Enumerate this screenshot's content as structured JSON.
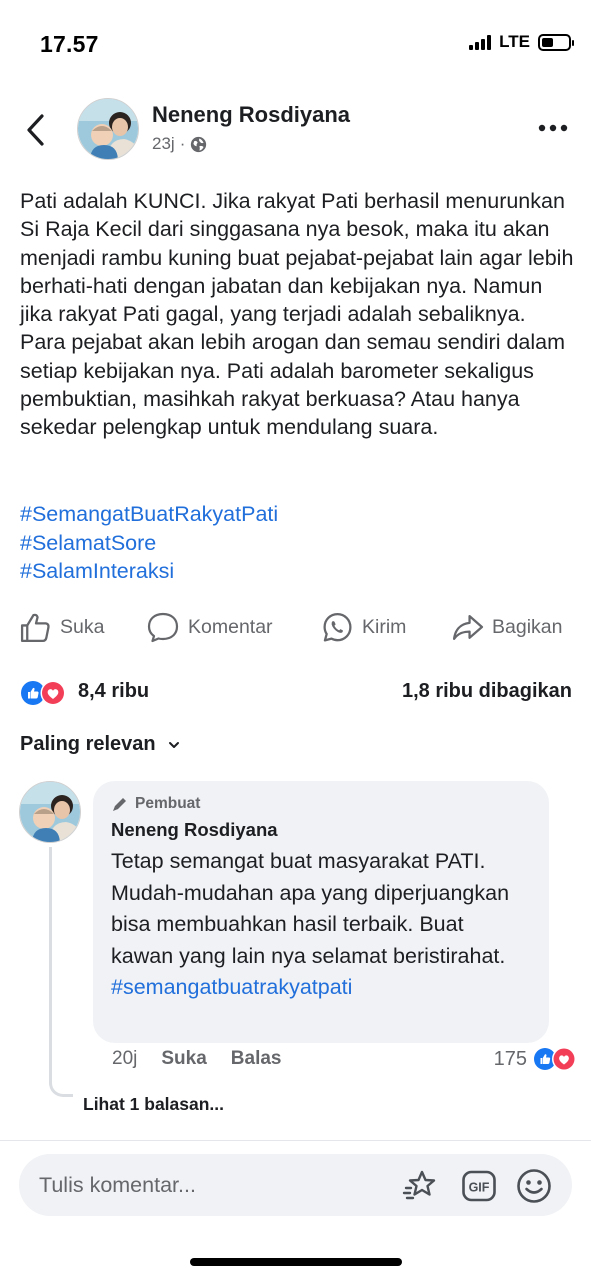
{
  "status_bar": {
    "time": "17.57",
    "network": "LTE",
    "battery_level": 0.45
  },
  "header": {
    "author_name": "Neneng Rosdiyana",
    "post_age": "23j",
    "separator": "·",
    "privacy_icon": "globe-icon"
  },
  "post": {
    "text": "Pati adalah KUNCI. Jika rakyat Pati berhasil menurunkan Si Raja Kecil dari singgasana nya besok, maka itu akan menjadi rambu kuning buat pejabat-pejabat lain agar lebih berhati-hati dengan jabatan dan kebijakan nya. Namun jika rakyat Pati gagal, yang terjadi adalah sebaliknya. Para pejabat akan lebih arogan dan semau sendiri dalam setiap kebijakan nya. Pati adalah barometer sekaligus pembuktian, masihkah rakyat berkuasa? Atau hanya sekedar pelengkap untuk mendulang suara.",
    "hashtags": [
      "#SemangatBuatRakyatPati",
      "#SelamatSore",
      "#SalamInteraksi"
    ]
  },
  "actions": {
    "like": "Suka",
    "comment": "Komentar",
    "send": "Kirim",
    "share": "Bagikan"
  },
  "stats": {
    "reactions_count": "8,4 ribu",
    "shares": "1,8 ribu dibagikan"
  },
  "sort": {
    "label": "Paling relevan"
  },
  "comment": {
    "badge": "Pembuat",
    "author": "Neneng Rosdiyana",
    "text": "Tetap semangat buat masyarakat PATI. Mudah-mudahan apa yang diperjuangkan bisa membuahkan hasil terbaik. Buat kawan yang lain nya selamat beristirahat.",
    "hashtag": "#semangatbuatrakyatpati",
    "age": "20j",
    "like": "Suka",
    "reply": "Balas",
    "reactions_count": "175",
    "view_replies": "Lihat 1 balasan..."
  },
  "composer": {
    "placeholder": "Tulis komentar..."
  },
  "colors": {
    "link": "#216fdb",
    "like_blue": "#1877f2",
    "love_red": "#f33e58",
    "muted": "#65676b"
  }
}
